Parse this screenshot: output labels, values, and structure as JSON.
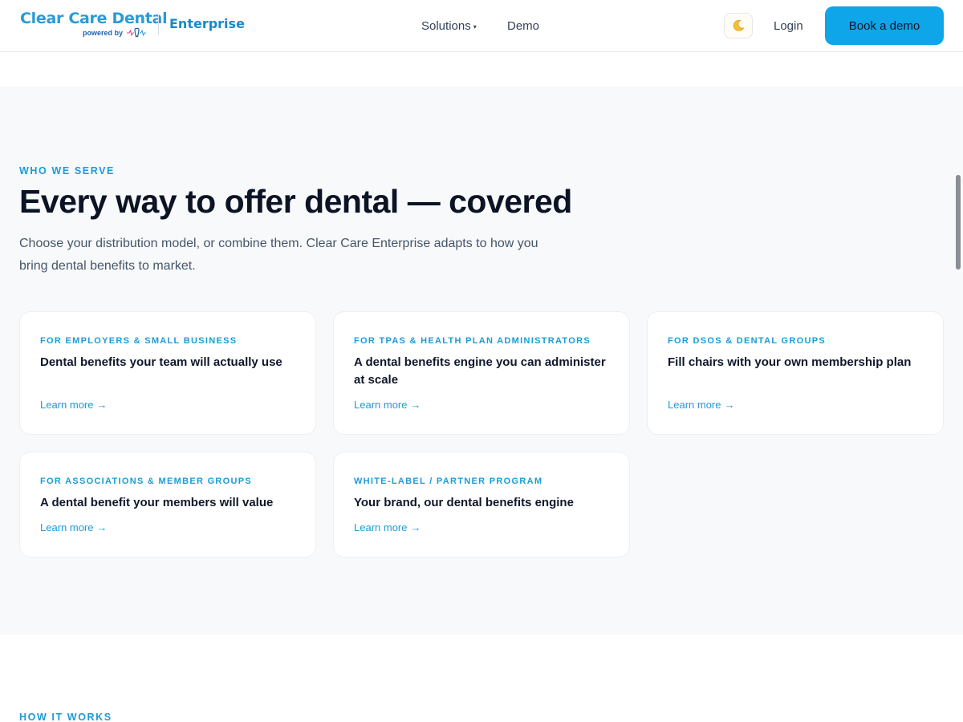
{
  "brand": {
    "logo_text": "Clear Care Dental",
    "powered_by": "powered by",
    "product": "Enterprise",
    "accent": "#2a9bd8"
  },
  "nav": {
    "solutions": "Solutions",
    "solutions_caret": "▾",
    "demo": "Demo",
    "theme_icon": "moon-icon",
    "login": "Login",
    "cta": "Book a demo",
    "cta_color": "#0ea5e9"
  },
  "serve": {
    "eyebrow": "WHO WE SERVE",
    "heading": "Every way to offer dental — covered",
    "lead": "Choose your distribution model, or combine them. Clear Care Enterprise adapts to how you bring dental benefits to market.",
    "cards": [
      {
        "tag": "FOR EMPLOYERS & SMALL BUSINESS",
        "title": "Dental benefits your team will actually use",
        "link": "Learn more",
        "arrow": "→"
      },
      {
        "tag": "FOR TPAS & HEALTH PLAN ADMINISTRATORS",
        "title": "A dental benefits engine you can administer at scale",
        "link": "Learn more",
        "arrow": "→"
      },
      {
        "tag": "FOR DSOS & DENTAL GROUPS",
        "title": "Fill chairs with your own membership plan",
        "link": "Learn more",
        "arrow": "→"
      },
      {
        "tag": "FOR ASSOCIATIONS & MEMBER GROUPS",
        "title": "A dental benefit your members will value",
        "link": "Learn more",
        "arrow": "→"
      },
      {
        "tag": "WHITE-LABEL / PARTNER PROGRAM",
        "title": "Your brand, our dental benefits engine",
        "link": "Learn more",
        "arrow": "→"
      }
    ]
  },
  "how": {
    "eyebrow": "HOW IT WORKS"
  }
}
